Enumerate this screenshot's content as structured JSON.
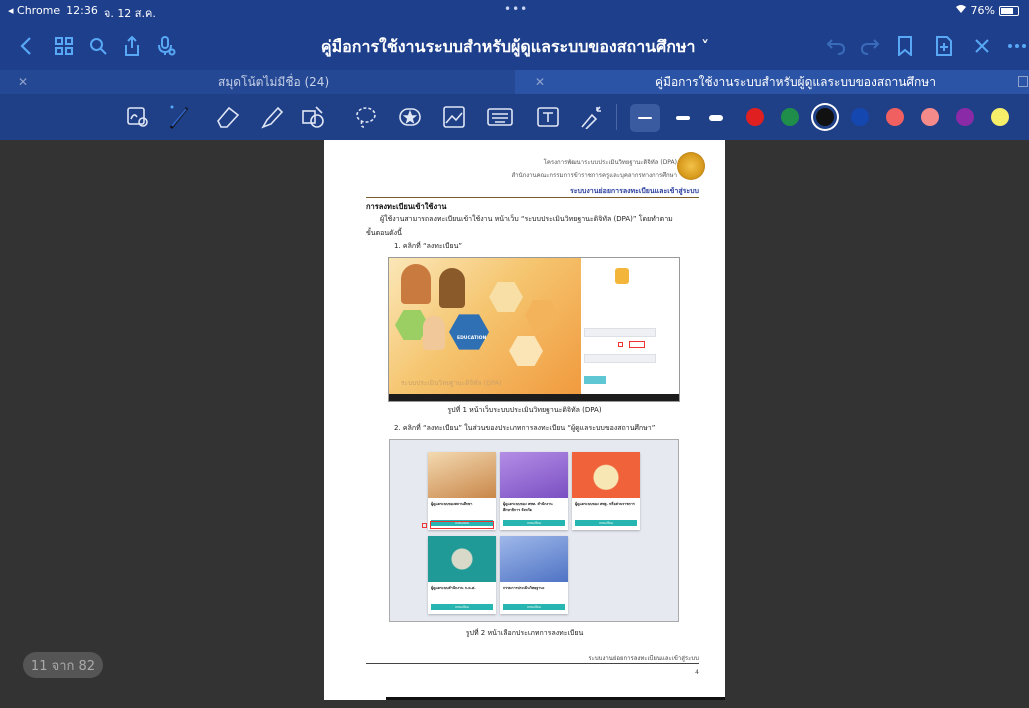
{
  "status_bar": {
    "back_app": "◂ Chrome",
    "time": "12:36",
    "date": "จ. 12 ส.ค.",
    "dots": "•••",
    "battery": "76%",
    "battery_level": 0.76
  },
  "nav": {
    "title": "คู่มือการใช้งานระบบสำหรับผู้ดูแลระบบของสถานศึกษา ˅"
  },
  "tabs": [
    {
      "label": "สมุดโน้ตไม่มีชื่อ (24)",
      "active": false
    },
    {
      "label": "คู่มือการใช้งานระบบสำหรับผู้ดูแลระบบของสถานศึกษา",
      "active": true
    }
  ],
  "toolbar": {
    "pen_colors": [
      "#ffffff",
      "#ffffff",
      "#ffffff",
      "#e02020",
      "#1e8e4a",
      "#111111",
      "#1448b0",
      "#f06060",
      "#f58a8a",
      "#8a2aa6",
      "#f7ee6a"
    ],
    "selected_color": "#111111"
  },
  "document": {
    "page_indicator": "11 จาก 82",
    "header_line1": "โครงการพัฒนาระบบประเมินวิทยฐานะดิจิทัล (DPA)",
    "header_line2": "สำนักงานคณะกรรมการข้าราชการครูและบุคลากรทางการศึกษา",
    "header_line3": "ระบบงานย่อยการลงทะเบียนและเข้าสู่ระบบ",
    "section_title": "การลงทะเบียนเข้าใช้งาน",
    "para1": "ผู้ใช้งานสามารถลงทะเบียนเข้าใช้งาน หน้าเว็บ “ระบบประเมินวิทยฐานะดิจิทัล (DPA)” โดยทำตาม",
    "para2": "ขั้นตอนดังนี้",
    "step1": "1. คลิกที่ “ลงทะเบียน”",
    "shot1_edu": "EDUCATION",
    "shot1_caption_text": "ระบบประเมินวิทยฐานะดิจิทัล (DPA)",
    "caption1": "รูปที่ 1 หน้าเว็บระบบประเมินวิทยฐานะดิจิทัล (DPA)",
    "step2": "2. คลิกที่ “ลงทะเบียน” ในส่วนของประเภทการลงทะเบียน “ผู้ดูแลระบบของสถานศึกษา”",
    "cards": [
      {
        "title": "ผู้ดูแลระบบของสถานศึกษา",
        "button": "ลงทะเบียน",
        "color": "#e9b26a"
      },
      {
        "title": "ผู้ดูแลระบบของ สพท. สำนักงานศึกษาธิการ จังหวัด",
        "button": "ลงทะเบียน",
        "color": "#9c6fd6"
      },
      {
        "title": "ผู้ดูแลระบบของ สพฐ. หรือส่วนราชการ",
        "button": "ลงทะเบียน",
        "color": "#f0623a"
      },
      {
        "title": "ผู้ดูแลระบบสำนักงาน ก.ค.ศ.",
        "button": "ลงทะเบียน",
        "color": "#1f9a96"
      },
      {
        "title": "กรรมการประเมินวิทยฐานะ",
        "button": "ลงทะเบียน",
        "color": "#6c8fd4"
      }
    ],
    "caption2": "รูปที่ 2 หน้าเลือกประเภทการลงทะเบียน",
    "footer": "ระบบงานย่อยการลงทะเบียนและเข้าสู่ระบบ",
    "page_number": "4"
  }
}
